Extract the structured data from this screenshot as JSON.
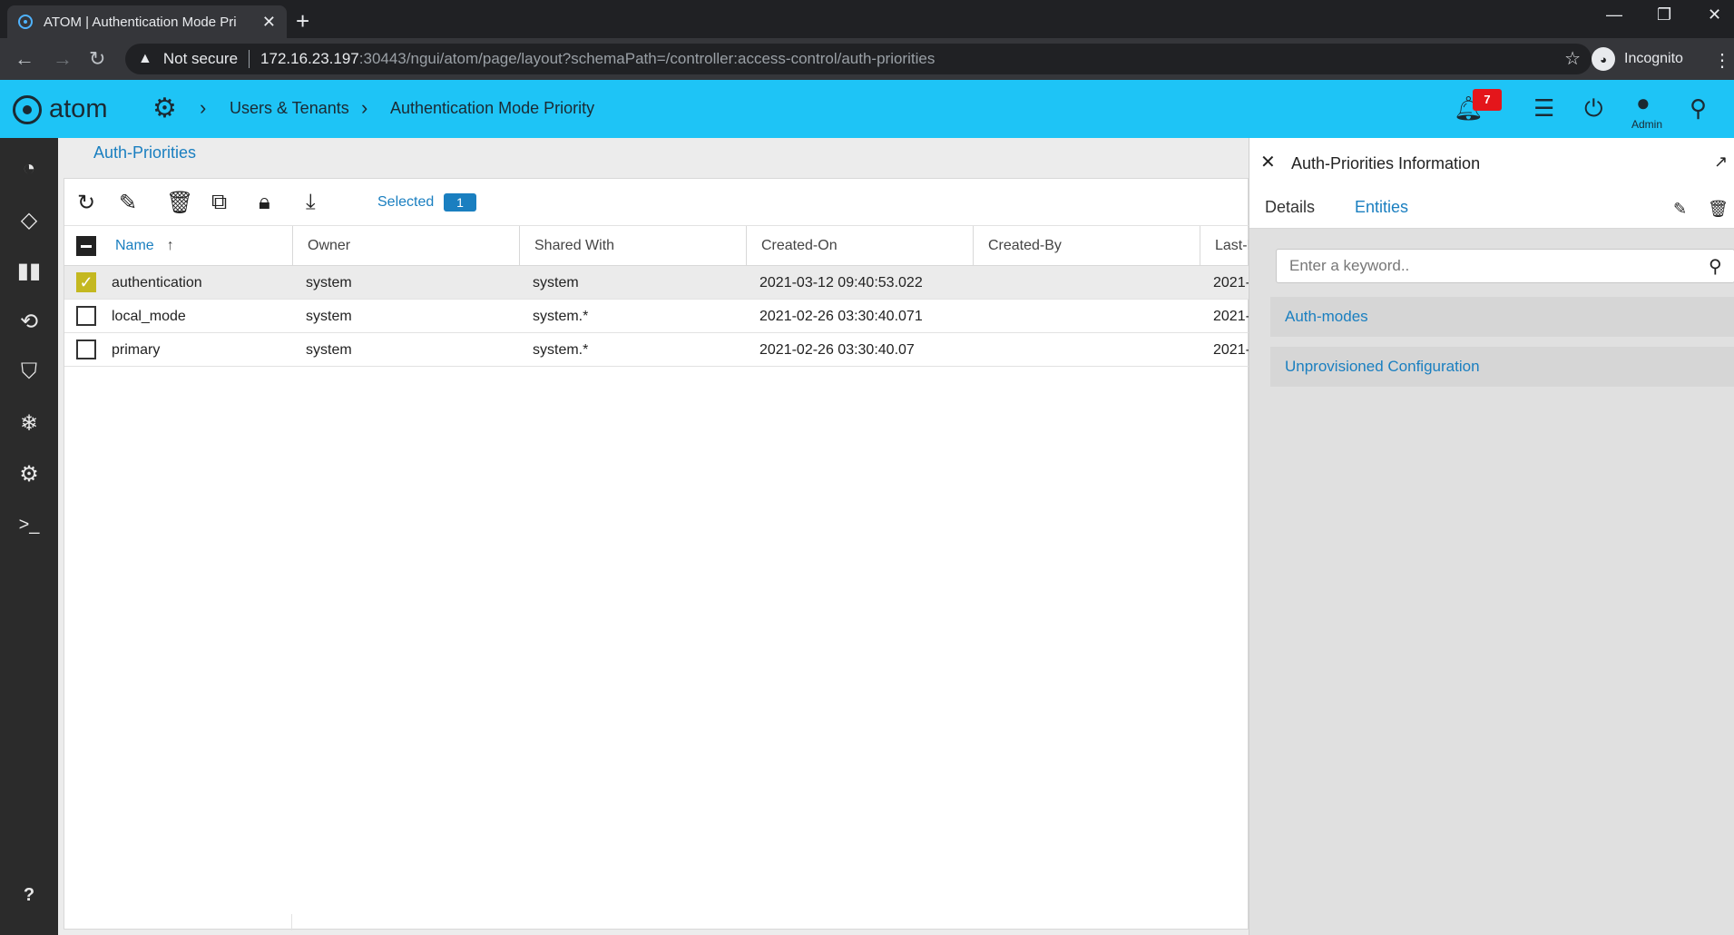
{
  "browser": {
    "tab_title": "ATOM | Authentication Mode Pri",
    "not_secure": "Not secure",
    "url_host": "172.16.23.197",
    "url_path": ":30443/ngui/atom/page/layout?schemaPath=/controller:access-control/auth-priorities",
    "profile": "Incognito"
  },
  "header": {
    "logo_text": "atom",
    "breadcrumb": [
      "Users & Tenants",
      "Authentication Mode Priority"
    ],
    "notification_count": "7",
    "user_label": "Admin"
  },
  "main": {
    "title": "Auth-Priorities",
    "selected_label": "Selected",
    "selected_count": "1",
    "columns": [
      "Name",
      "Owner",
      "Shared With",
      "Created-On",
      "Created-By",
      "Last-M"
    ],
    "rows": [
      {
        "name": "authentication",
        "owner": "system",
        "shared_with": "system",
        "created_on": "2021-03-12 09:40:53.022",
        "created_by": "",
        "last_modified": "2021-",
        "selected": true
      },
      {
        "name": "local_mode",
        "owner": "system",
        "shared_with": "system.*",
        "created_on": "2021-02-26 03:30:40.071",
        "created_by": "",
        "last_modified": "2021-",
        "selected": false
      },
      {
        "name": "primary",
        "owner": "system",
        "shared_with": "system.*",
        "created_on": "2021-02-26 03:30:40.07",
        "created_by": "",
        "last_modified": "2021-",
        "selected": false
      }
    ]
  },
  "info_panel": {
    "title": "Auth-Priorities Information",
    "tabs": [
      "Details",
      "Entities"
    ],
    "search_placeholder": "Enter a keyword..",
    "entities": [
      "Auth-modes",
      "Unprovisioned Configuration"
    ]
  },
  "colors": {
    "header_bg": "#1ec4f6",
    "sidebar_bg": "#2b2b2b",
    "accent": "#1a7fc0",
    "badge": "#e4161b",
    "checkbox_checked": "#c4b820"
  }
}
